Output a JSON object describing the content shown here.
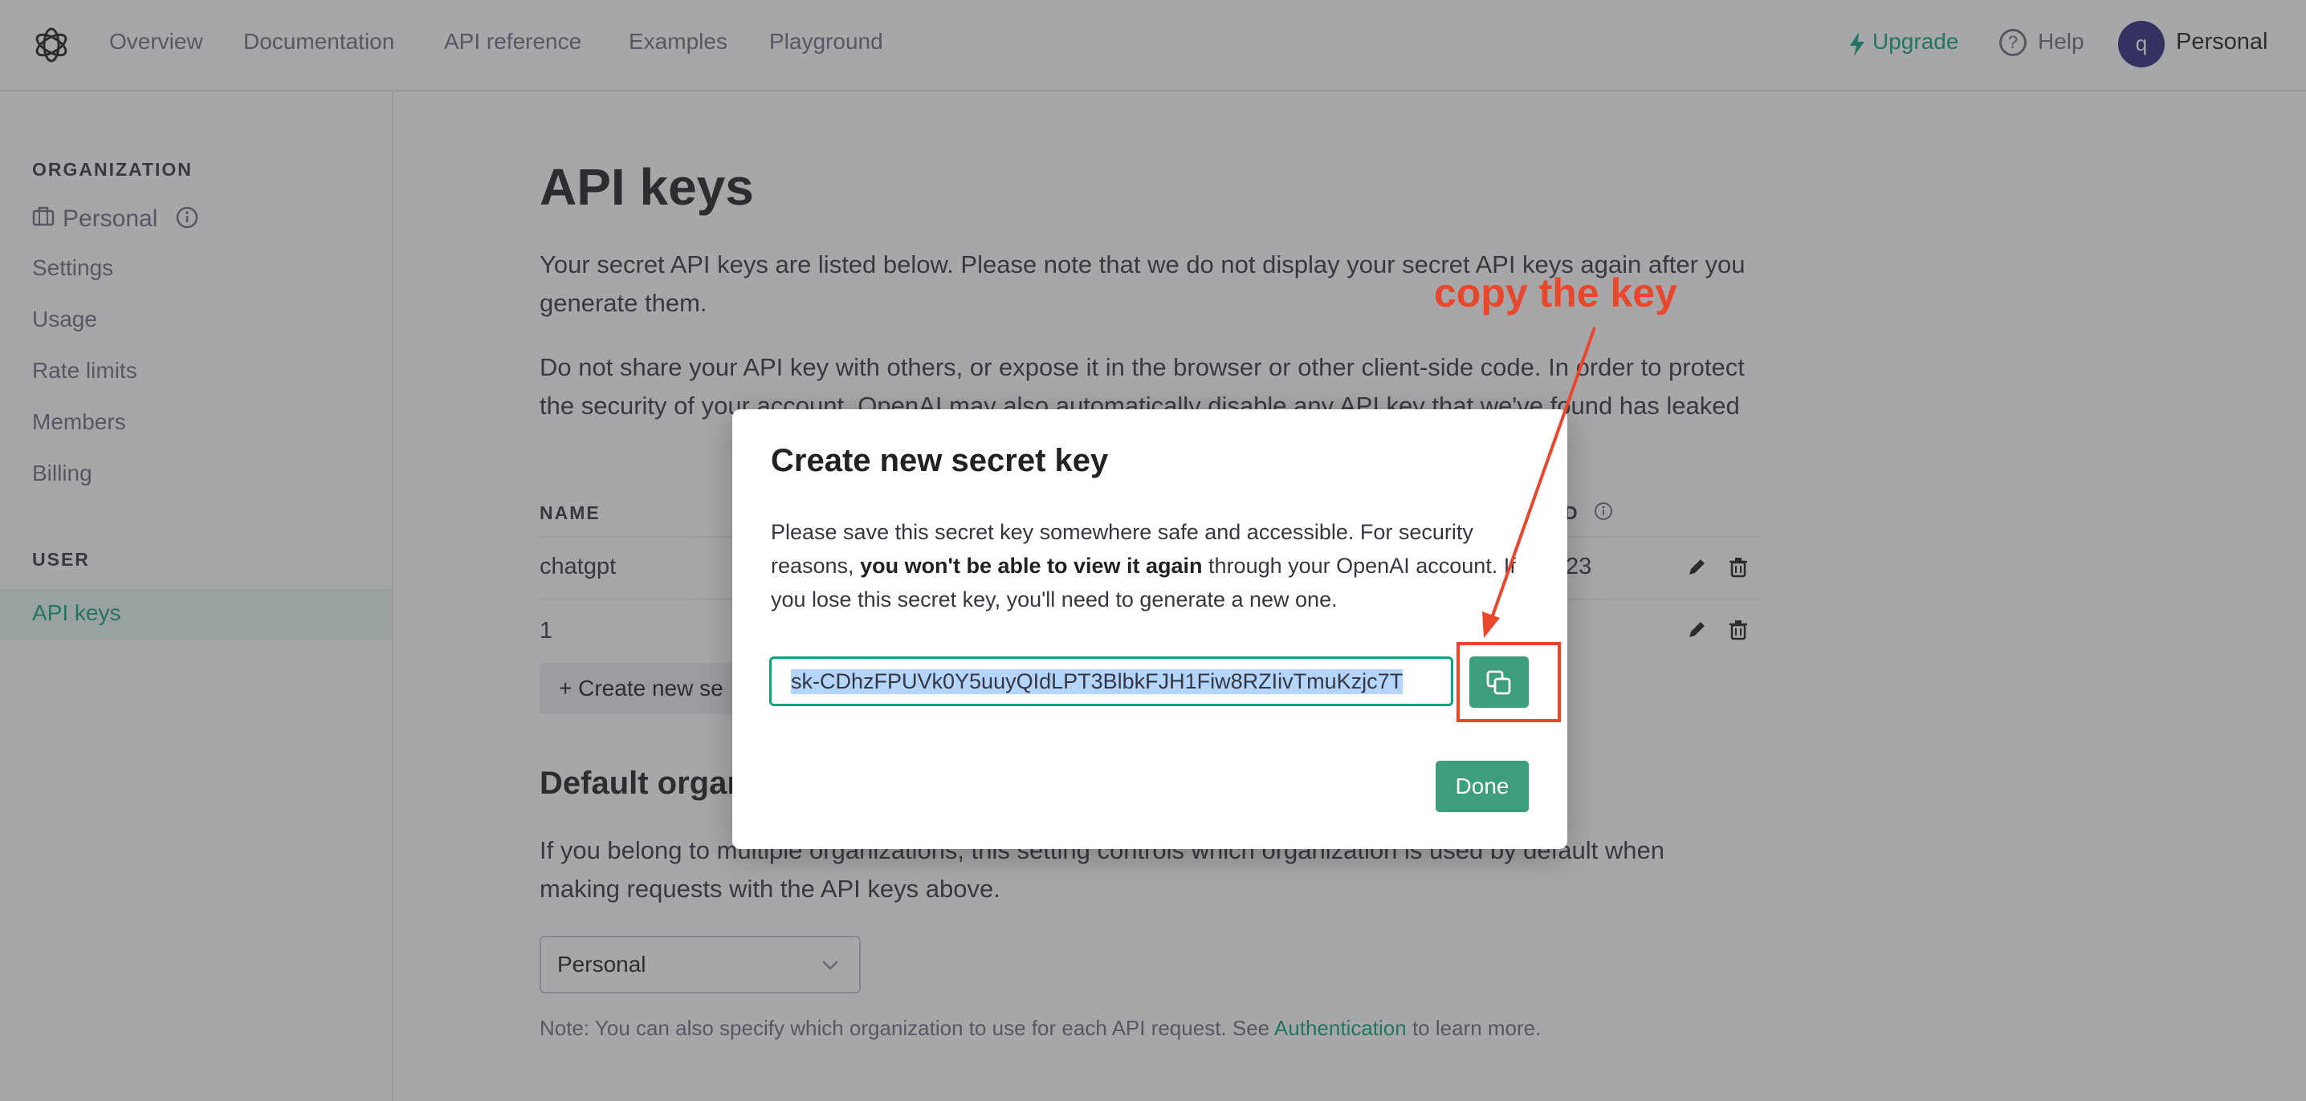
{
  "nav": {
    "links": [
      "Overview",
      "Documentation",
      "API reference",
      "Examples",
      "Playground"
    ],
    "upgrade": "Upgrade",
    "help": "Help",
    "avatar_initial": "q",
    "account": "Personal"
  },
  "sidebar": {
    "org_heading": "ORGANIZATION",
    "org_name": "Personal",
    "items": [
      "Settings",
      "Usage",
      "Rate limits",
      "Members",
      "Billing"
    ],
    "user_heading": "USER",
    "active_item": "API keys"
  },
  "main": {
    "title": "API keys",
    "para1": "Your secret API keys are listed below. Please note that we do not display your secret API keys again after you generate them.",
    "para2": "Do not share your API key with others, or expose it in the browser or other client-side code. In order to protect the security of your account, OpenAI may also automatically disable any API key that we've found has leaked",
    "col_name": "NAME",
    "col_used": "D",
    "rows": [
      {
        "name": "chatgpt",
        "used": "23"
      },
      {
        "name": "1",
        "used": ""
      }
    ],
    "create_button": "+  Create new se",
    "section_title": "Default organ",
    "section_para": "If you belong to multiple organizations, this setting controls which organization is used by default when making requests with the API keys above.",
    "select_value": "Personal",
    "note_prefix": "Note: You can also specify which organization to use for each API request. See ",
    "note_link": "Authentication",
    "note_suffix": " to learn more."
  },
  "modal": {
    "title": "Create new secret key",
    "body_1": "Please save this secret key somewhere safe and accessible. For security reasons, ",
    "body_bold": "you won't be able to view it again",
    "body_2": " through your OpenAI account. If you lose this secret key, you'll need to generate a new one.",
    "key_value": "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",
    "done": "Done"
  },
  "annotation": {
    "text": "copy the key",
    "color": "#e8472c"
  },
  "colors": {
    "accent": "#10a37f",
    "button_green": "#3d9e7d"
  }
}
